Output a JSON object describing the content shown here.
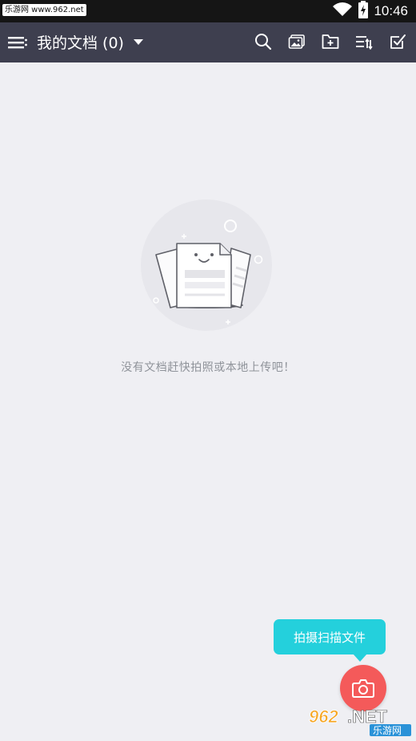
{
  "statusbar": {
    "watermark": "乐游网 www.962.net",
    "time": "10:46",
    "icons": [
      "wifi-icon",
      "battery-charging-icon"
    ]
  },
  "appbar": {
    "title": "我的文档 (0)",
    "menu_icon": "menu-icon",
    "dropdown_icon": "caret-down-icon",
    "actions": [
      "search-icon",
      "image-import-icon",
      "new-folder-icon",
      "sort-icon",
      "select-check-icon"
    ]
  },
  "content": {
    "empty_message": "没有文档赶快拍照或本地上传吧！"
  },
  "fab": {
    "tooltip": "拍摄扫描文件",
    "icon": "camera-icon"
  },
  "watermark_bottom": {
    "logo": "962.NET",
    "text": "乐游网"
  },
  "colors": {
    "statusbar": "#151515",
    "appbar": "#3e3f4f",
    "background": "#efeff3",
    "tooltip": "#24d0dc",
    "fab": "#f45a5a",
    "empty_text": "#8f939a"
  }
}
